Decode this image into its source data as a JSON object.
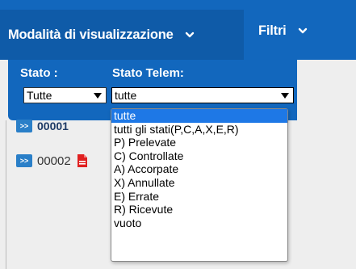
{
  "header": {
    "tabs": [
      {
        "label": "Modalità di visualizzazione"
      },
      {
        "label": "Filtri"
      }
    ]
  },
  "filters": {
    "stato": {
      "label": "Stato :",
      "value": "Tutte"
    },
    "stato_telem": {
      "label": "Stato Telem:",
      "value": "tutte"
    }
  },
  "table": {
    "rows": [
      {
        "button": ">>",
        "number": "00001"
      },
      {
        "button": ">>",
        "number": "00002"
      }
    ]
  },
  "dropdown": {
    "options": [
      "tutte",
      "tutti gli stati(P,C,A,X,E,R)",
      "P) Prelevate",
      "C) Controllate",
      "A) Accorpate",
      "X) Annullate",
      "E) Errate",
      "R) Ricevute",
      "vuoto"
    ],
    "selected_index": 0
  },
  "colors": {
    "header_blue": "#1267bd",
    "header_active": "#0f5ba8",
    "selection": "#1e78e6",
    "pdf_red": "#e02020"
  },
  "icons": {
    "tab_chevron": "chevron-down-icon",
    "document": "pdf-icon"
  }
}
